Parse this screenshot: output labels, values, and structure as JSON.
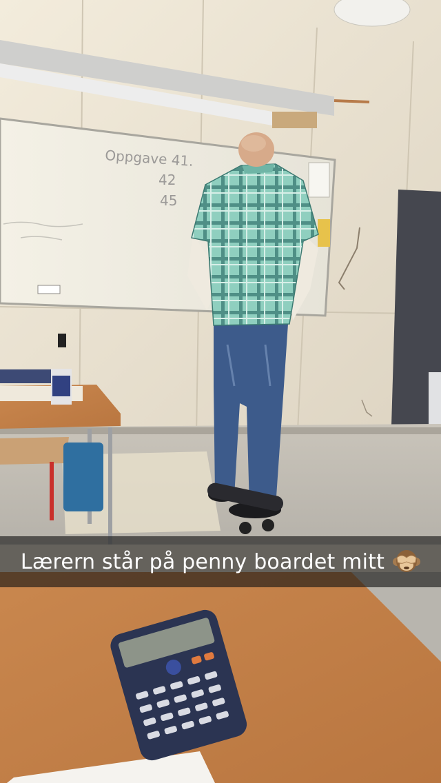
{
  "snap": {
    "caption": "Lærern står på penny boardet mitt",
    "caption_emoji": "see-no-evil-monkey-icon"
  },
  "whiteboard": {
    "line1": "Oppgave 41.",
    "line2": "42",
    "line3": "45"
  },
  "colors": {
    "caption_bar": "#141414",
    "caption_text": "#ffffff"
  }
}
